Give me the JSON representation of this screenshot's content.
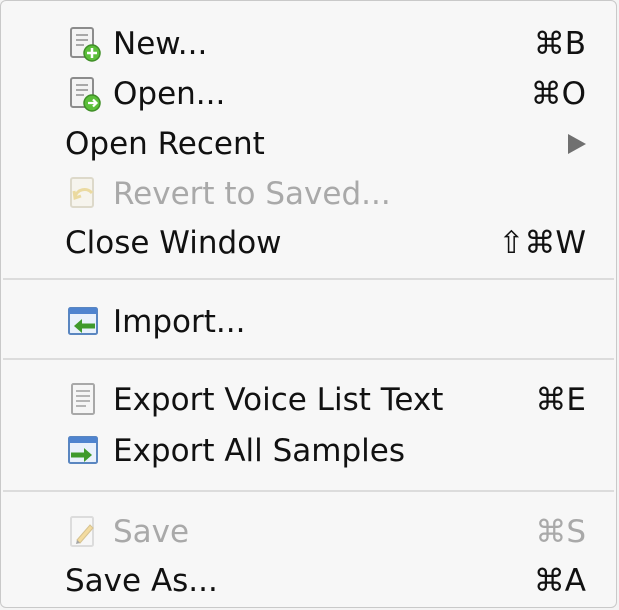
{
  "menu": {
    "items": [
      {
        "label": "New...",
        "shortcut": "⌘B",
        "icon": "new-document-icon",
        "enabled": true
      },
      {
        "label": "Open...",
        "shortcut": "⌘O",
        "icon": "open-document-icon",
        "enabled": true
      },
      {
        "label": "Open Recent",
        "submenu": true,
        "icon": "submenu-arrow-icon",
        "enabled": true
      },
      {
        "label": "Revert to Saved...",
        "icon": "revert-icon",
        "enabled": false
      },
      {
        "label": "Close Window",
        "shortcut": "⇧⌘W",
        "enabled": true
      },
      {
        "label": "Import...",
        "icon": "import-icon",
        "enabled": true
      },
      {
        "label": "Export Voice List Text",
        "shortcut": "⌘E",
        "icon": "text-document-icon",
        "enabled": true
      },
      {
        "label": "Export All Samples",
        "icon": "export-icon",
        "enabled": true
      },
      {
        "label": "Save",
        "shortcut": "⌘S",
        "icon": "save-pencil-icon",
        "enabled": false
      },
      {
        "label": "Save As...",
        "shortcut": "⌘A",
        "enabled": true
      }
    ]
  },
  "colors": {
    "menu_background": "#f7f7f7",
    "enabled_text": "#111111",
    "disabled_text": "#a9a9a9",
    "separator": "#dcdcdc"
  }
}
